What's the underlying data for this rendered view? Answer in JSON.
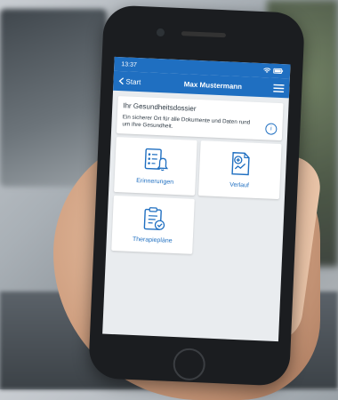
{
  "statusbar": {
    "time": "13:37"
  },
  "topbar": {
    "back_label": "Start",
    "title": "Max Mustermann"
  },
  "info_card": {
    "heading": "Ihr Gesundheitsdossier",
    "text": "Ein sicherer Ort für alle Dokumente und Daten rund um Ihre Gesundheit."
  },
  "tiles": [
    {
      "label": "Erinnerungen",
      "icon": "reminders-icon"
    },
    {
      "label": "Verlauf",
      "icon": "history-icon"
    },
    {
      "label": "Therapiepläne",
      "icon": "therapy-plan-icon"
    }
  ],
  "colors": {
    "accent": "#1f6fc1",
    "background": "#e9ecef"
  }
}
